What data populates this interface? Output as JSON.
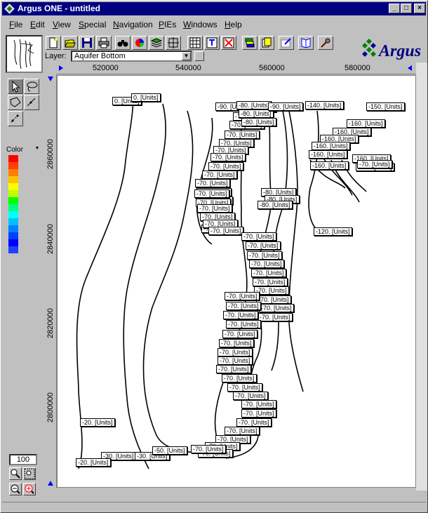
{
  "window": {
    "title": "Argus ONE - untitled",
    "title_color": "#000080"
  },
  "menu": [
    {
      "label": "File",
      "u": "F",
      "rest": "ile"
    },
    {
      "label": "Edit",
      "u": "E",
      "rest": "dit"
    },
    {
      "label": "View",
      "u": "V",
      "rest": "iew"
    },
    {
      "label": "Special",
      "u": "S",
      "rest": "pecial"
    },
    {
      "label": "Navigation",
      "u": "N",
      "rest": "avigation"
    },
    {
      "label": "PIEs",
      "u": "P",
      "rest": "IEs"
    },
    {
      "label": "Windows",
      "u": "W",
      "rest": "indows"
    },
    {
      "label": "Help",
      "u": "H",
      "rest": "elp"
    }
  ],
  "layer": {
    "label": "Layer:",
    "value": "Aquifer Bottom"
  },
  "brand": {
    "name": "Argus",
    "accent": "#008000",
    "text_color": "#000080"
  },
  "ruler": {
    "x_ticks": [
      "520000",
      "540000",
      "560000",
      "580000"
    ],
    "y_ticks": [
      "2860000",
      "2840000",
      "2820000",
      "2800000"
    ]
  },
  "palette": {
    "color_label": "Color",
    "colors": [
      "#ff0000",
      "#ff4000",
      "#ff8000",
      "#ffc000",
      "#ffff00",
      "#c0ff00",
      "#00ff00",
      "#00ff80",
      "#00ffff",
      "#00c0ff",
      "#0080ff",
      "#0040ff",
      "#0000ff",
      "#2040ff"
    ]
  },
  "zoom": {
    "value": "100"
  },
  "contour_labels": [
    {
      "text": "0. [Units]"
    },
    {
      "text": "-70. [Units]"
    },
    {
      "text": "-80. [Units]"
    },
    {
      "text": "-90. [Units]"
    },
    {
      "text": "-140. [Units]"
    },
    {
      "text": "-150. [Units]"
    },
    {
      "text": "-160. [Units]"
    },
    {
      "text": "-120. [Units]"
    },
    {
      "text": "-20. [Units]"
    },
    {
      "text": "-30. [Units]"
    },
    {
      "text": "-50. [Units]"
    }
  ]
}
